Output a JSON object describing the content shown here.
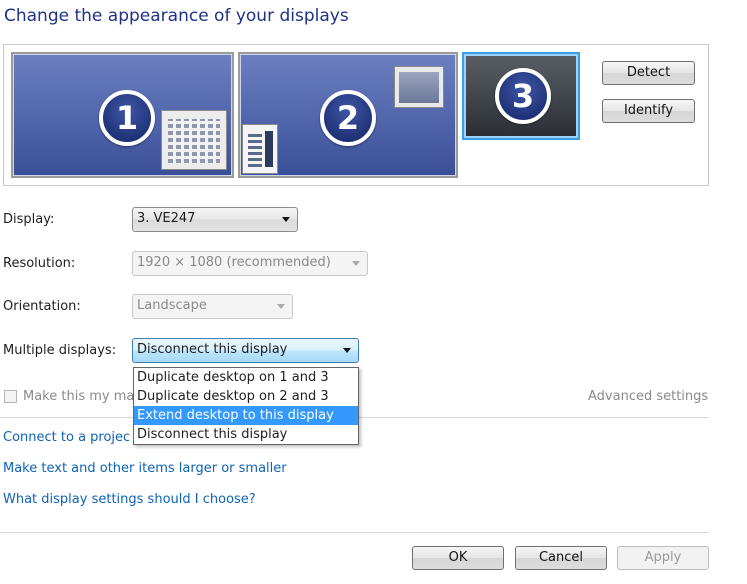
{
  "page": {
    "title": "Change the appearance of your displays"
  },
  "monitors": [
    {
      "number": "1",
      "selected": false
    },
    {
      "number": "2",
      "selected": false
    },
    {
      "number": "3",
      "selected": true
    }
  ],
  "side_buttons": {
    "detect": "Detect",
    "identify": "Identify"
  },
  "settings": {
    "display": {
      "label": "Display:",
      "value": "3. VE247"
    },
    "resolution": {
      "label": "Resolution:",
      "value": "1920 × 1080 (recommended)",
      "enabled": false
    },
    "orientation": {
      "label": "Orientation:",
      "value": "Landscape",
      "enabled": false
    },
    "multiple": {
      "label": "Multiple displays:",
      "value": "Disconnect this display"
    }
  },
  "multiple_options": [
    {
      "label": "Duplicate desktop on 1 and 3",
      "highlighted": false
    },
    {
      "label": "Duplicate desktop on 2 and 3",
      "highlighted": false
    },
    {
      "label": "Extend desktop to this display",
      "highlighted": true
    },
    {
      "label": "Disconnect this display",
      "highlighted": false
    }
  ],
  "main_checkbox": {
    "label": "Make this my ma",
    "checked": false,
    "enabled": false
  },
  "advanced_link": "Advanced settings",
  "links": {
    "projector": "Connect to a projec",
    "text_size": "Make text and other items larger or smaller",
    "what_settings": "What display settings should I choose?"
  },
  "footer": {
    "ok": "OK",
    "cancel": "Cancel",
    "apply": "Apply"
  },
  "colors": {
    "title": "#1e3287",
    "link": "#0d63b8",
    "highlight": "#3399ff"
  }
}
